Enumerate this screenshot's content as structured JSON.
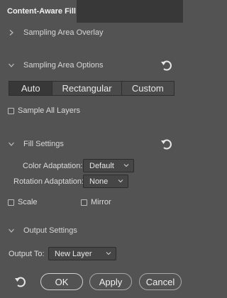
{
  "panel": {
    "title": "Content-Aware Fill"
  },
  "sections": {
    "sampling_overlay": {
      "label": "Sampling Area Overlay",
      "expanded": false
    },
    "sampling_options": {
      "label": "Sampling Area Options",
      "expanded": true
    },
    "fill_settings": {
      "label": "Fill Settings",
      "expanded": true
    },
    "output_settings": {
      "label": "Output Settings",
      "expanded": true
    }
  },
  "sampling_mode": {
    "options": [
      "Auto",
      "Rectangular",
      "Custom"
    ],
    "selected": "Auto"
  },
  "sample_all_layers": {
    "label": "Sample All Layers",
    "checked": false
  },
  "color_adaptation": {
    "label": "Color Adaptation:",
    "value": "Default"
  },
  "rotation_adaptation": {
    "label": "Rotation Adaptation:",
    "value": "None"
  },
  "scale": {
    "label": "Scale",
    "checked": false
  },
  "mirror": {
    "label": "Mirror",
    "checked": false
  },
  "output_to": {
    "label": "Output To:",
    "value": "New Layer"
  },
  "buttons": {
    "ok": "OK",
    "apply": "Apply",
    "cancel": "Cancel"
  },
  "icons": {
    "reset": "reset-icon",
    "chevron_right": "chevron-right-icon",
    "chevron_down": "chevron-down-icon"
  },
  "colors": {
    "panel_bg": "#535353",
    "tabbar_bg": "#383838",
    "text": "#dcdcdc",
    "selected_segment": "#383838"
  }
}
